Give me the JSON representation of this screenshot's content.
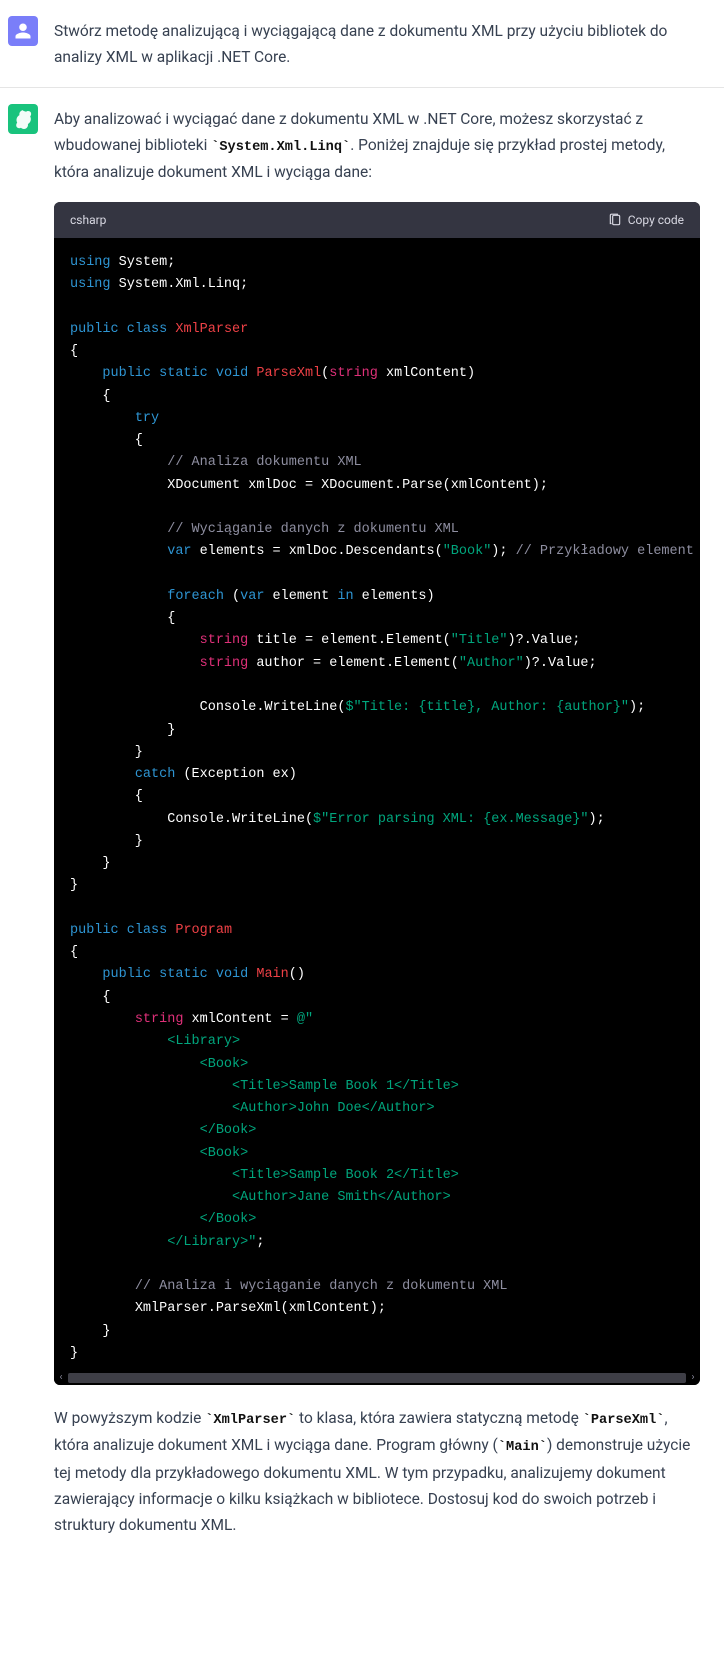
{
  "user_message": "Stwórz metodę analizującą i wyciągającą dane z dokumentu XML przy użyciu bibliotek do analizy XML w aplikacji .NET Core.",
  "ai_intro_1": "Aby analizować i wyciągać dane z dokumentu XML w .NET Core, możesz skorzystać z wbudowanej biblioteki ",
  "ai_intro_code": "`System.Xml.Linq`",
  "ai_intro_2": ". Poniżej znajduje się przykład prostej metody, która analizuje dokument XML i wyciąga dane:",
  "code": {
    "lang": "csharp",
    "copy_label": "Copy code",
    "t": {
      "using": "using",
      "system": " System;",
      "sysxml": " System.Xml.Linq;",
      "public": "public",
      "class": "class",
      "xmlparser": "XmlParser",
      "static": "static",
      "void": "void",
      "parsexml": "ParseXml",
      "paren_o": "(",
      "string_kw": "string",
      "xmlcontent_param": " xmlContent)",
      "try": "try",
      "c_analiza": "// Analiza dokumentu XML",
      "xdoc_line": "XDocument xmlDoc = XDocument.Parse(xmlContent);",
      "c_wyciag": "// Wyciąganie danych z dokumentu XML",
      "var": "var",
      "elements_pre": " elements = xmlDoc.Descendants(",
      "book": "\"Book\"",
      "elements_post": "); ",
      "c_przyk": "// Przykładowy element",
      "foreach": "foreach",
      "foreach_mid1": " (",
      "foreach_mid2": " element ",
      "in": "in",
      "foreach_end": " elements)",
      "title_pre": " title = element.Element(",
      "title_str": "\"Title\"",
      "q_value": ")?.Value;",
      "author_pre": " author = element.Element(",
      "author_str": "\"Author\"",
      "cw": "Console.WriteLine(",
      "dollar": "$\"Title: {title}, Author: {author}\"",
      "cw_end": ");",
      "catch": "catch",
      "catch_rest": " (Exception ex)",
      "err_str": "$\"Error parsing XML: {ex.Message}\"",
      "program": "Program",
      "main": "Main",
      "main_par": "()",
      "xmlcontent_decl": " xmlContent = ",
      "at": "@\"",
      "x1": "            <Library>",
      "x2": "                <Book>",
      "x3": "                    <Title>Sample Book 1</Title>",
      "x4": "                    <Author>John Doe</Author>",
      "x5": "                </Book>",
      "x6": "                <Book>",
      "x7": "                    <Title>Sample Book 2</Title>",
      "x8": "                    <Author>Jane Smith</Author>",
      "x9": "                </Book>",
      "x10_a": "            </Library>\"",
      "x10_b": ";",
      "c_analiza2": "// Analiza i wyciąganie danych z dokumentu XML",
      "call": "XmlParser.ParseXml(xmlContent);"
    }
  },
  "ai_outro_1": "W powyższym kodzie ",
  "ai_outro_c1": "`XmlParser`",
  "ai_outro_2": " to klasa, która zawiera statyczną metodę ",
  "ai_outro_c2": "`ParseXml`",
  "ai_outro_3": ", która analizuje dokument XML i wyciąga dane. Program główny (",
  "ai_outro_c3": "`Main`",
  "ai_outro_4": ") demonstruje użycie tej metody dla przykładowego dokumentu XML. W tym przypadku, analizujemy dokument zawierający informacje o kilku książkach w bibliotece. Dostosuj kod do swoich potrzeb i struktury dokumentu XML."
}
